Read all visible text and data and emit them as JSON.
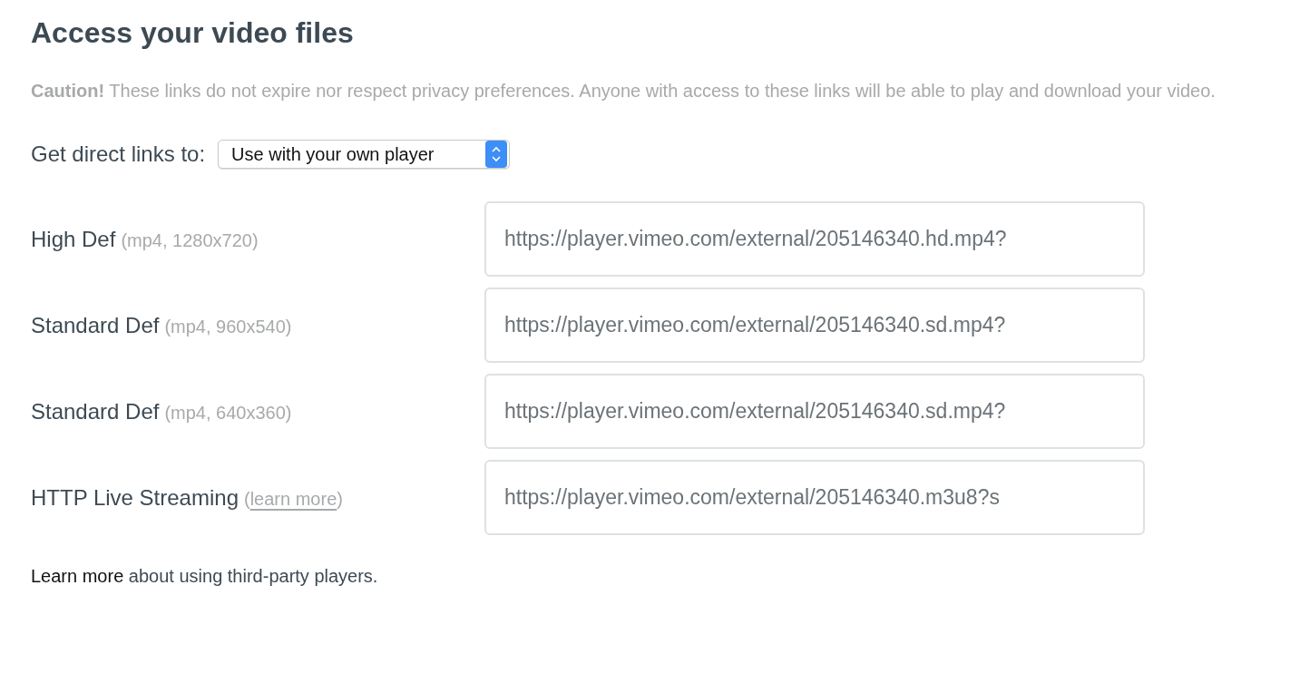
{
  "heading": "Access your video files",
  "caution": "**Caution!** These links do not expire nor respect privacy preferences. Anyone with access to these links will be able to play and download your video.",
  "selector": {
    "label": "Get direct links to:",
    "value": "Use with your own player"
  },
  "links": [
    {
      "kind": "format",
      "name": "High Def",
      "detail": "(mp4, 1280x720)",
      "url": "https://player.vimeo.com/external/205146340.hd.mp4?"
    },
    {
      "kind": "format",
      "name": "Standard Def",
      "detail": "(mp4, 960x540)",
      "url": "https://player.vimeo.com/external/205146340.sd.mp4?"
    },
    {
      "kind": "format",
      "name": "Standard Def",
      "detail": "(mp4, 640x360)",
      "url": "https://player.vimeo.com/external/205146340.sd.mp4?"
    },
    {
      "kind": "link",
      "name": "HTTP Live Streaming",
      "detail_prefix": "(",
      "detail_link": "learn more",
      "detail_suffix": ")",
      "url": "https://player.vimeo.com/external/205146340.m3u8?s"
    }
  ],
  "footer": {
    "link": "Learn more",
    "text": "about using third-party players."
  }
}
